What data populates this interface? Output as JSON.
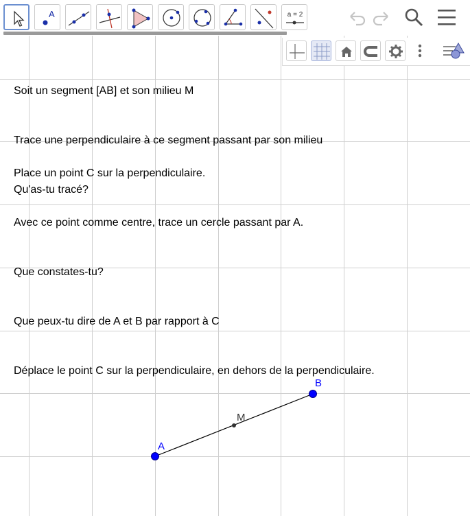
{
  "toolbar": {
    "tools": [
      {
        "name": "move-tool-button",
        "icon": "pointer-arrow-icon",
        "selected": true
      },
      {
        "name": "point-tool-button",
        "icon": "point-icon",
        "label": "A"
      },
      {
        "name": "line-tool-button",
        "icon": "line-through-two-points-icon"
      },
      {
        "name": "perpendicular-line-tool-button",
        "icon": "perpendicular-line-icon"
      },
      {
        "name": "polygon-tool-button",
        "icon": "polygon-icon"
      },
      {
        "name": "circle-tool-button",
        "icon": "circle-with-center-icon"
      },
      {
        "name": "circle-through-points-tool-button",
        "icon": "circle-through-three-points-icon"
      },
      {
        "name": "angle-tool-button",
        "icon": "angle-icon"
      },
      {
        "name": "reflect-tool-button",
        "icon": "reflect-about-line-icon"
      },
      {
        "name": "slider-tool-button",
        "icon": "slider-icon",
        "label": "a = 2"
      }
    ],
    "right_icons": [
      "undo-icon",
      "redo-icon",
      "search-icon",
      "menu-icon"
    ]
  },
  "style_bar": {
    "buttons": [
      "show-axes-icon",
      "show-grid-icon",
      "home-icon",
      "point-capturing-icon",
      "settings-icon",
      "more-vertical-icon",
      "toggle-style-bar-icon"
    ]
  },
  "text": {
    "block1": [
      "Soit un segment [AB] et son milieu M",
      "Trace une perpendiculaire à ce segment passant par son milieu",
      "Qu'as-tu tracé?"
    ],
    "block2": [
      "Place un point C sur la perpendiculaire.",
      "Avec ce point comme centre, trace un cercle passant par A.",
      "Que constates-tu?",
      "Que peux-tu dire de A et B par rapport à C",
      "Déplace le point C sur la perpendiculaire, en dehors de la perpendiculaire."
    ]
  },
  "points": {
    "A": {
      "label": "A",
      "color": "#0000ff"
    },
    "B": {
      "label": "B",
      "color": "#0000ff"
    },
    "M": {
      "label": "M",
      "color": "#333333"
    }
  },
  "colors": {
    "grid": "#cfcfcf",
    "accent": "#6b8fd0",
    "point": "#0000ff"
  }
}
